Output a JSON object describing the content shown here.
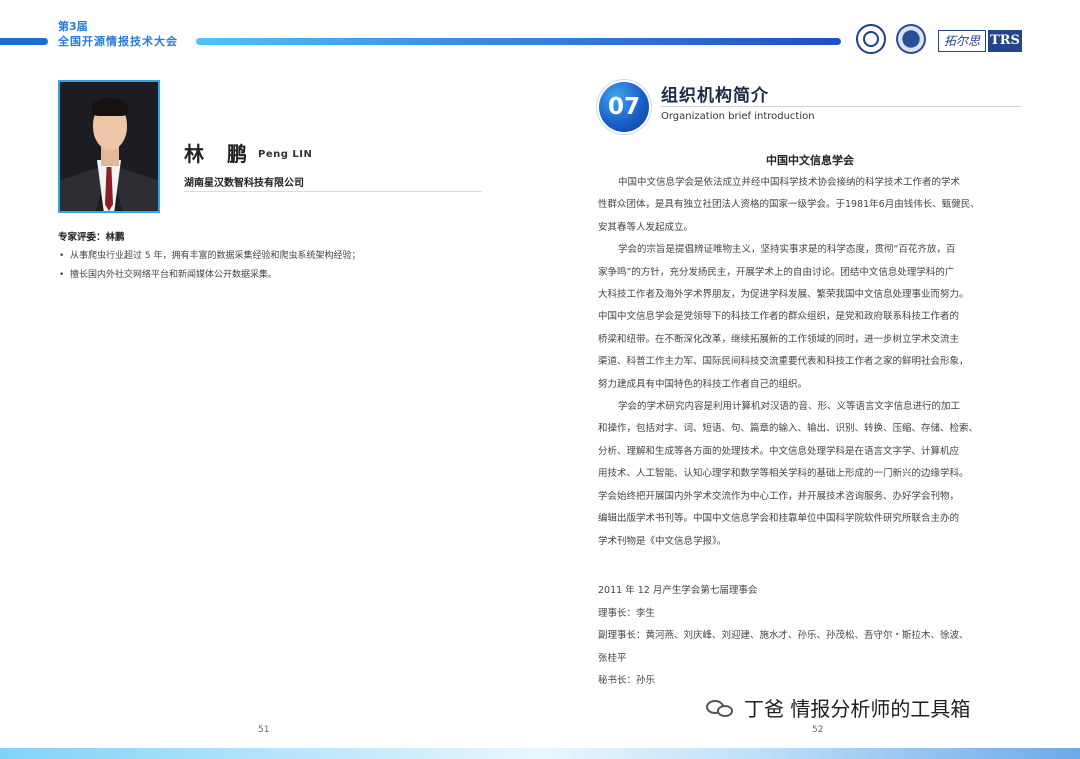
{
  "header": {
    "edition": "第3届",
    "conference": "全国开源情报技术大会",
    "logos": [
      "conference-seal-logo",
      "society-emblem-logo",
      "tuoersi-trs-logo"
    ],
    "trs_logo_cn": "拓尔思",
    "trs_logo_en": "TRS"
  },
  "left_page": {
    "name_cn": "林 鹏",
    "name_en": "Peng LIN",
    "company": "湖南星汉数智科技有限公司",
    "expert_title": "专家评委：林鹏",
    "bullets": [
      "从事爬虫行业超过 5 年，拥有丰富的数据采集经验和爬虫系统架构经验；",
      "擅长国内外社交网络平台和新闻媒体公开数据采集。"
    ],
    "page_number": "51"
  },
  "right_page": {
    "section_number": "07",
    "section_title": "组织机构简介",
    "section_subtitle": "Organization brief introduction",
    "org_name": "中国中文信息学会",
    "paragraph1": [
      "中国中文信息学会是依法成立并经中国科学技术协会接纳的科学技术工作者的学术",
      "性群众团体，是具有独立社团法人资格的国家一级学会。于1981年6月由钱伟长、甄健民、",
      "安其春等人发起成立。"
    ],
    "paragraph2": [
      "学会的宗旨是提倡辨证唯物主义，坚持实事求是的科学态度，贯彻“百花齐放，百",
      "家争鸣”的方针，充分发扬民主，开展学术上的自由讨论。团结中文信息处理学科的广",
      "大科技工作者及海外学术界朋友，为促进学科发展、繁荣我国中文信息处理事业而努力。",
      "中国中文信息学会是党领导下的科技工作者的群众组织，是党和政府联系科技工作者的",
      "桥梁和纽带。在不断深化改革，继续拓展新的工作领域的同时，进一步树立学术交流主",
      "渠道、科普工作主力军、国际民间科技交流重要代表和科技工作者之家的鲜明社会形象，",
      "努力建成具有中国特色的科技工作者自己的组织。"
    ],
    "paragraph3": [
      "学会的学术研究内容是利用计算机对汉语的音、形、义等语言文字信息进行的加工",
      "和操作，包括对字、词、短语、句、篇章的输入、输出、识别、转换、压缩、存储、检索、",
      "分析、理解和生成等各方面的处理技术。中文信息处理学科是在语言文字学、计算机应",
      "用技术、人工智能、认知心理学和数学等相关学科的基础上形成的一门新兴的边缘学科。",
      "学会始终把开展国内外学术交流作为中心工作，并开展技术咨询服务、办好学会刊物，",
      "编辑出版学术书刊等。中国中文信息学会和挂靠单位中国科学院软件研究所联合主办的",
      "学术刊物是《中文信息学报》。"
    ],
    "council": [
      "2011 年 12 月产生学会第七届理事会",
      "理事长：李生",
      "副理事长：黄河燕、刘庆峰、刘迎建、施水才、孙乐、孙茂松、吾守尔・斯拉木、徐波、",
      "张桂平",
      "秘书长：孙乐"
    ],
    "page_number": "52"
  },
  "watermark": {
    "icon": "wechat-icon",
    "text": "丁爸 情报分析师的工具箱"
  }
}
